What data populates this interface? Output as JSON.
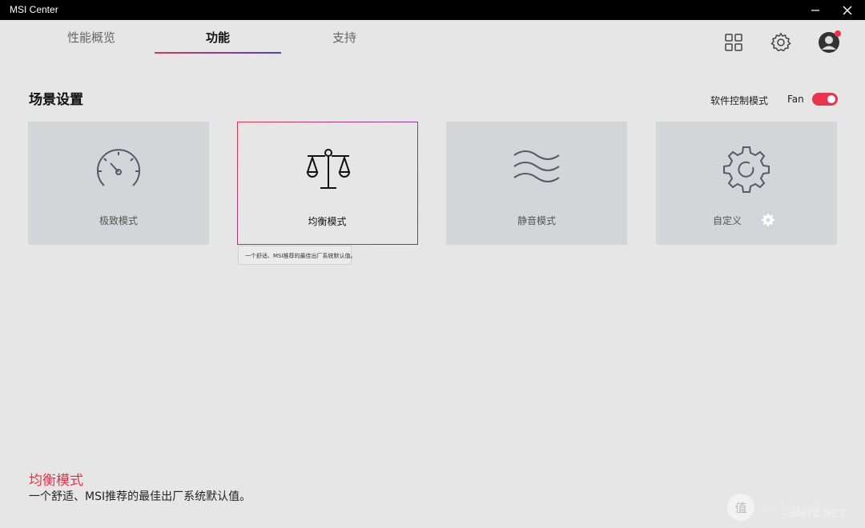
{
  "window": {
    "title": "MSI Center"
  },
  "tabs": [
    {
      "label": "性能概览",
      "active": false
    },
    {
      "label": "功能",
      "active": true
    },
    {
      "label": "支持",
      "active": false
    }
  ],
  "top_icons": [
    "grid-icon",
    "gear-icon",
    "avatar"
  ],
  "section": {
    "title": "场景设置",
    "mode_label": "软件控制模式",
    "fan_label": "Fan",
    "toggle_on": true
  },
  "cards": [
    {
      "label": "极致模式",
      "icon": "speedometer-icon",
      "selected": false
    },
    {
      "label": "均衡模式",
      "icon": "balance-scale-icon",
      "selected": true
    },
    {
      "label": "静音模式",
      "icon": "waves-icon",
      "selected": false
    },
    {
      "label": "自定义",
      "icon": "cog-icon",
      "selected": false
    }
  ],
  "tooltip": {
    "text": "一个舒适、MSI推荐的最佳出厂系统默认值。"
  },
  "description": {
    "title": "均衡模式",
    "text": "一个舒适、MSI推荐的最佳出厂系统默认值。"
  },
  "watermark": {
    "glyph": "值",
    "text": "什么值得买",
    "sub": "SMYZ.NET"
  },
  "colors": {
    "accent": "#e8334a",
    "accent2": "#4a3dd9",
    "titlebar": "#000000"
  }
}
